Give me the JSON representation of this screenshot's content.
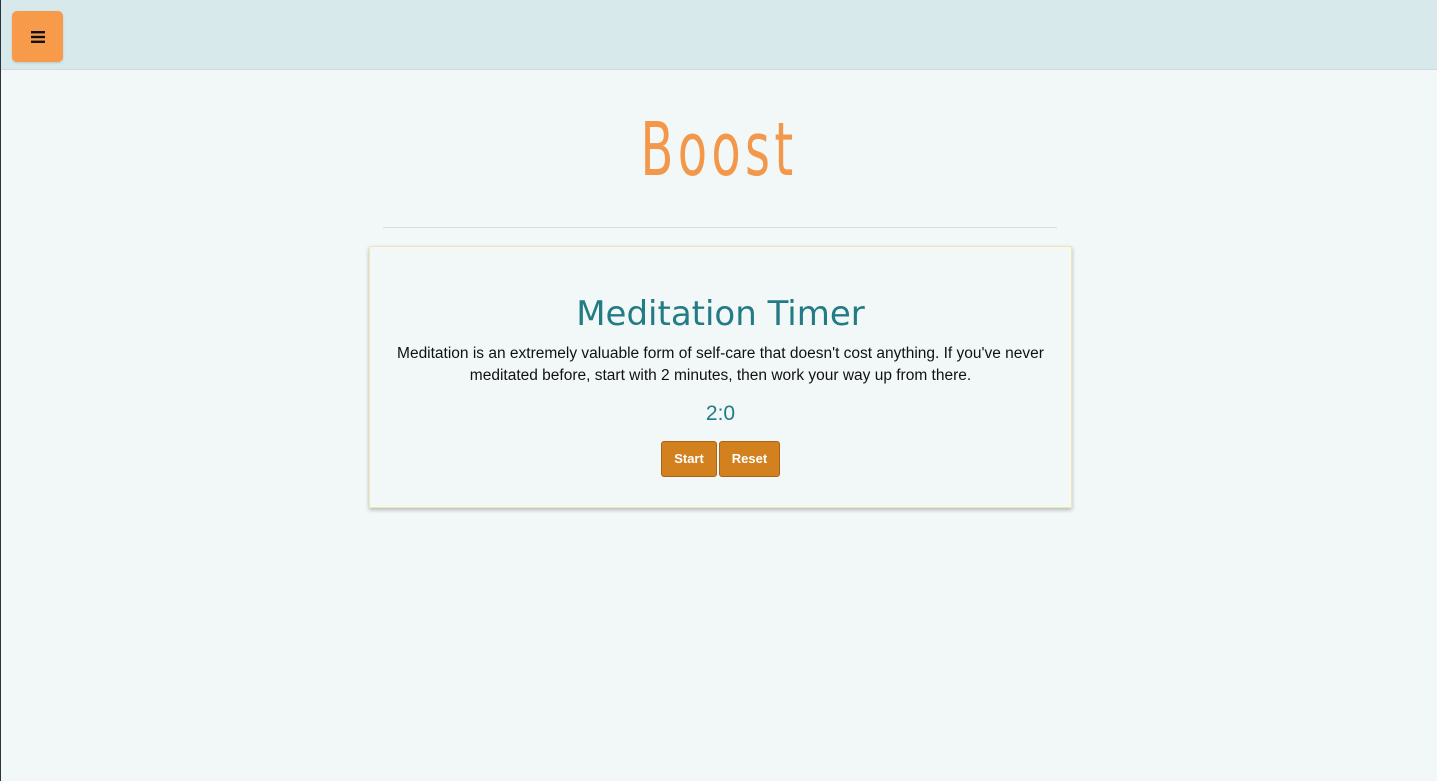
{
  "header": {
    "menu_icon": "hamburger-menu-icon"
  },
  "brand": {
    "title": "Boost",
    "color": "#f3984a"
  },
  "meditation": {
    "title": "Meditation Timer",
    "description": "Meditation is an extremely valuable form of self-care that doesn't cost anything. If you've never meditated before, start with 2 minutes, then work your way up from there.",
    "timer_display": "2:0",
    "start_label": "Start",
    "reset_label": "Reset"
  },
  "colors": {
    "accent": "#f79a4a",
    "button": "#d3801f",
    "heading": "#237b85",
    "header_bg": "#d8e9ec",
    "page_bg": "#f2f8f8"
  }
}
